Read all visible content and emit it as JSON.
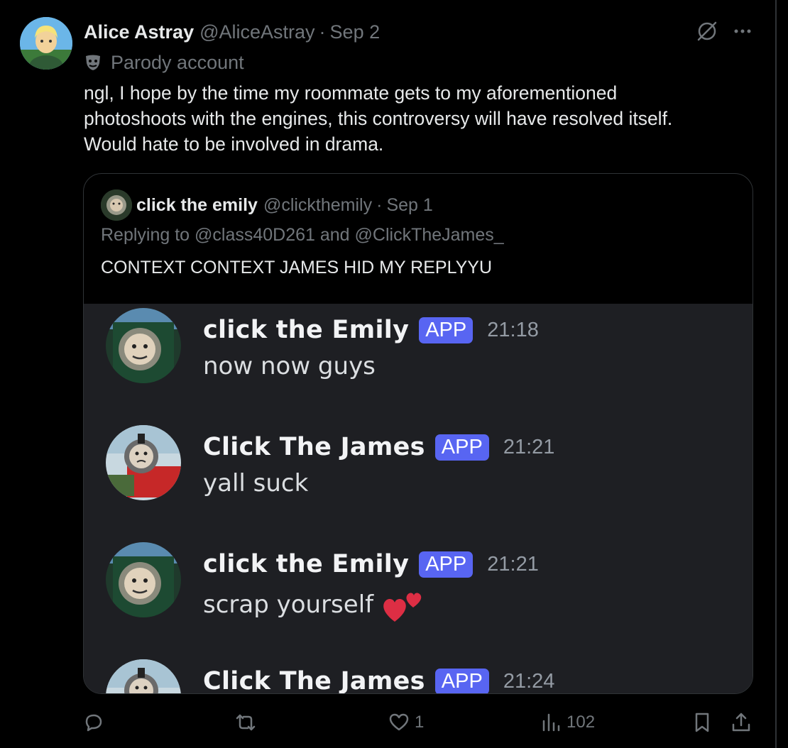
{
  "tweet": {
    "display_name": "Alice Astray",
    "handle": "@AliceAstray",
    "date": "Sep 2",
    "parody_label": "Parody account",
    "text": "ngl, I hope by the time my roommate gets to my aforementioned\nphotoshoots with the engines, this controversy will have resolved itself.\nWould hate to be involved in drama."
  },
  "quote": {
    "display_name": "click the emily",
    "handle": "@clickthemily",
    "date": "Sep 1",
    "replying_to": "Replying to @class40D261 and @ClickTheJames_",
    "text": "CONTEXT CONTEXT JAMES HID MY REPLYYU",
    "messages": [
      {
        "author": "click the Emily",
        "badge": "APP",
        "time": "21:18",
        "body": "now now guys",
        "avatar": "green-engine"
      },
      {
        "author": "Click The James",
        "badge": "APP",
        "time": "21:21",
        "body": "yall suck",
        "avatar": "red-engine"
      },
      {
        "author": "click the Emily",
        "badge": "APP",
        "time": "21:21",
        "body": "scrap yourself",
        "avatar": "green-engine",
        "emoji": "two-hearts"
      },
      {
        "author": "Click The James",
        "badge": "APP",
        "time": "21:24",
        "body": "",
        "avatar": "red-engine"
      }
    ]
  },
  "actions": {
    "reply_count": "",
    "repost_count": "",
    "like_count": "1",
    "views_count": "102"
  },
  "icons": [
    "grok-icon",
    "more-icon",
    "parody-mask-icon",
    "reply-icon",
    "repost-icon",
    "like-icon",
    "views-icon",
    "bookmark-icon",
    "share-icon"
  ],
  "colors": {
    "background": "#000000",
    "text_primary": "#e7e9ea",
    "text_secondary": "#71767b",
    "border": "#2f3336",
    "discord_bg": "#1e1f23",
    "discord_badge": "#5865f2",
    "heart": "#dd2e44"
  }
}
